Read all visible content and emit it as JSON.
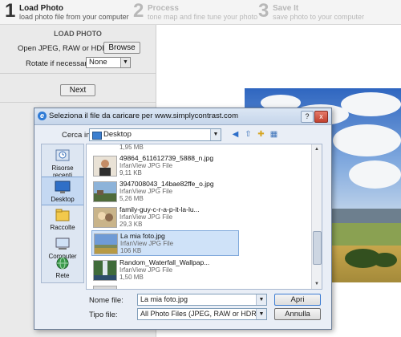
{
  "steps": [
    {
      "number": "1",
      "title": "Load Photo",
      "subtitle": "load photo file from your computer"
    },
    {
      "number": "2",
      "title": "Process",
      "subtitle": "tone map and fine tune your photo"
    },
    {
      "number": "3",
      "title": "Save It",
      "subtitle": "save photo to your computer"
    }
  ],
  "left_panel": {
    "title": "LOAD PHOTO",
    "open_label": "Open JPEG, RAW or HDR file",
    "browse_label": "Browse",
    "rotate_label": "Rotate if necessary",
    "rotate_value": "None",
    "next_label": "Next"
  },
  "dialog": {
    "title": "Seleziona il file da caricare per www.simplycontrast.com",
    "cerca_label": "Cerca in:",
    "cerca_value": "Desktop",
    "places": [
      {
        "label": "Risorse recenti",
        "icon": "recent-icon"
      },
      {
        "label": "Desktop",
        "icon": "desktop-icon"
      },
      {
        "label": "Raccolte",
        "icon": "libraries-icon"
      },
      {
        "label": "Computer",
        "icon": "computer-icon"
      },
      {
        "label": "Rete",
        "icon": "network-icon"
      }
    ],
    "files": [
      {
        "name": "",
        "type": "",
        "size": "1,95 MB"
      },
      {
        "name": "49864_611612739_5888_n.jpg",
        "type": "IrfanView JPG File",
        "size": "9,11 KB"
      },
      {
        "name": "3947008043_14bae82ffe_o.jpg",
        "type": "IrfanView JPG File",
        "size": "5,26 MB"
      },
      {
        "name": "family-guy-c-r-a-p-it-la-lu...",
        "type": "IrfanView JPG File",
        "size": "29,3 KB"
      },
      {
        "name": "La mia foto.jpg",
        "type": "IrfanView JPG File",
        "size": "106 KB"
      },
      {
        "name": "Random_Waterfall_Wallpap...",
        "type": "IrfanView JPG File",
        "size": "1,50 MB"
      }
    ],
    "filename_label": "Nome file:",
    "filename_value": "La mia foto.jpg",
    "filetype_label": "Tipo file:",
    "filetype_value": "All Photo Files (JPEG, RAW or HDR)",
    "open_button": "Apri",
    "cancel_button": "Annulla",
    "help_label": "?",
    "close_label": "x"
  },
  "colors": {
    "accent": "#3b7bd1",
    "selection": "#cfe2f8",
    "close": "#c1412f"
  }
}
